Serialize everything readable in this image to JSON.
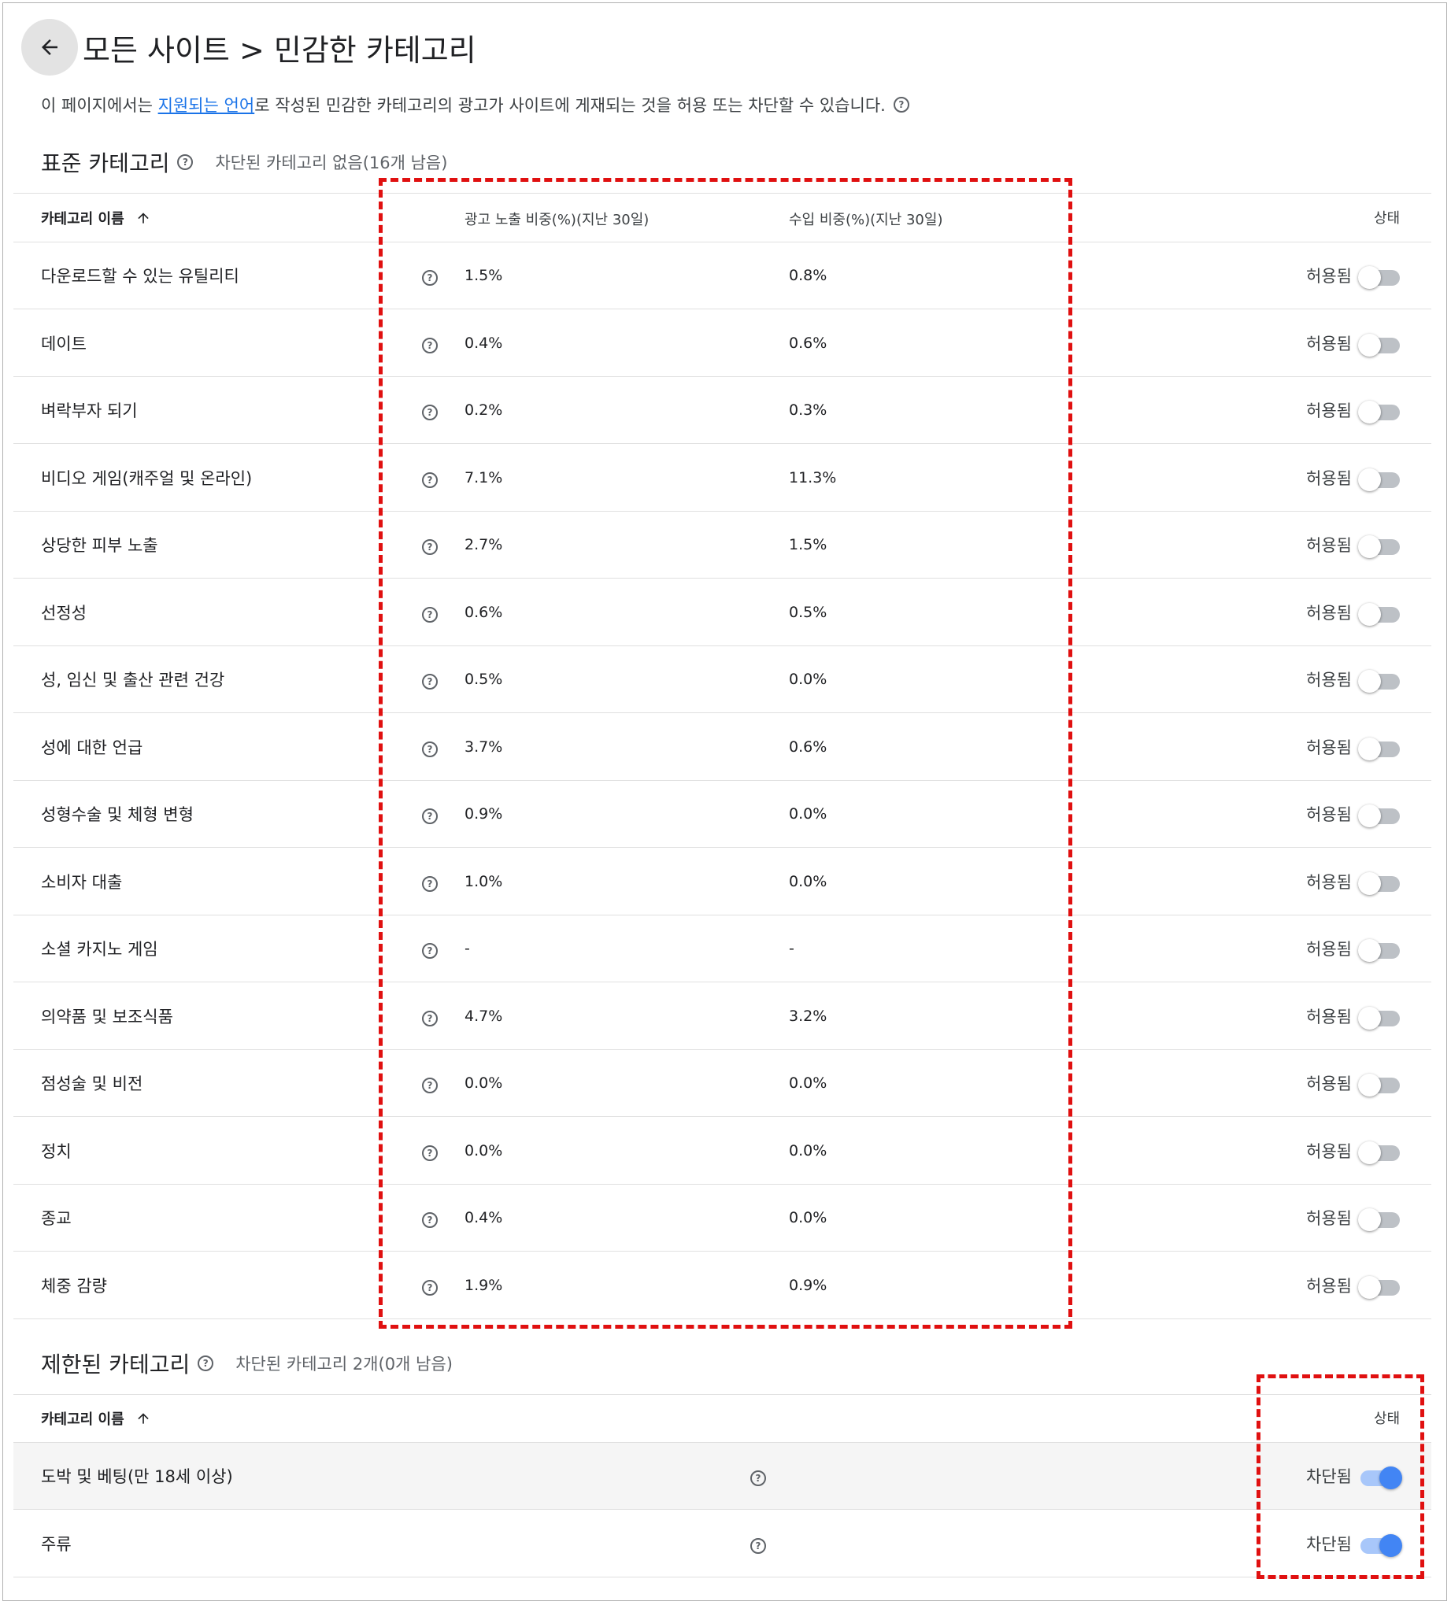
{
  "header": {
    "back_icon": "arrow-back-icon",
    "title": "모든 사이트 > 민감한 카테고리"
  },
  "description": {
    "prefix": "이 페이지에서는 ",
    "link": "지원되는 언어",
    "suffix": "로 작성된 민감한 카테고리의 광고가 사이트에 게재되는 것을 허용 또는 차단할 수 있습니다."
  },
  "standard": {
    "title": "표준 카테고리",
    "subtitle": "차단된 카테고리 없음(16개 남음)",
    "columns": {
      "name": "카테고리 이름",
      "impressions": "광고 노출 비중(%)(지난 30일)",
      "revenue": "수입 비중(%)(지난 30일)",
      "status": "상태"
    },
    "rows": [
      {
        "name": "다운로드할 수 있는 유틸리티",
        "impressions": "1.5%",
        "revenue": "0.8%",
        "status": "허용됨",
        "blocked": false
      },
      {
        "name": "데이트",
        "impressions": "0.4%",
        "revenue": "0.6%",
        "status": "허용됨",
        "blocked": false
      },
      {
        "name": "벼락부자 되기",
        "impressions": "0.2%",
        "revenue": "0.3%",
        "status": "허용됨",
        "blocked": false
      },
      {
        "name": "비디오 게임(캐주얼 및 온라인)",
        "impressions": "7.1%",
        "revenue": "11.3%",
        "status": "허용됨",
        "blocked": false
      },
      {
        "name": "상당한 피부 노출",
        "impressions": "2.7%",
        "revenue": "1.5%",
        "status": "허용됨",
        "blocked": false
      },
      {
        "name": "선정성",
        "impressions": "0.6%",
        "revenue": "0.5%",
        "status": "허용됨",
        "blocked": false
      },
      {
        "name": "성, 임신 및 출산 관련 건강",
        "impressions": "0.5%",
        "revenue": "0.0%",
        "status": "허용됨",
        "blocked": false
      },
      {
        "name": "성에 대한 언급",
        "impressions": "3.7%",
        "revenue": "0.6%",
        "status": "허용됨",
        "blocked": false
      },
      {
        "name": "성형수술 및 체형 변형",
        "impressions": "0.9%",
        "revenue": "0.0%",
        "status": "허용됨",
        "blocked": false
      },
      {
        "name": "소비자 대출",
        "impressions": "1.0%",
        "revenue": "0.0%",
        "status": "허용됨",
        "blocked": false
      },
      {
        "name": "소셜 카지노 게임",
        "impressions": "-",
        "revenue": "-",
        "status": "허용됨",
        "blocked": false
      },
      {
        "name": "의약품 및 보조식품",
        "impressions": "4.7%",
        "revenue": "3.2%",
        "status": "허용됨",
        "blocked": false
      },
      {
        "name": "점성술 및 비전",
        "impressions": "0.0%",
        "revenue": "0.0%",
        "status": "허용됨",
        "blocked": false
      },
      {
        "name": "정치",
        "impressions": "0.0%",
        "revenue": "0.0%",
        "status": "허용됨",
        "blocked": false
      },
      {
        "name": "종교",
        "impressions": "0.4%",
        "revenue": "0.0%",
        "status": "허용됨",
        "blocked": false
      },
      {
        "name": "체중 감량",
        "impressions": "1.9%",
        "revenue": "0.9%",
        "status": "허용됨",
        "blocked": false
      }
    ]
  },
  "restricted": {
    "title": "제한된 카테고리",
    "subtitle": "차단된 카테고리 2개(0개 남음)",
    "columns": {
      "name": "카테고리 이름",
      "status": "상태"
    },
    "rows": [
      {
        "name": "도박 및 베팅(만 18세 이상)",
        "status": "차단됨",
        "blocked": true
      },
      {
        "name": "주류",
        "status": "차단됨",
        "blocked": true
      }
    ]
  },
  "colors": {
    "link": "#1a73e8",
    "toggle_on": "#4285f4",
    "annotation": "#e01010"
  }
}
